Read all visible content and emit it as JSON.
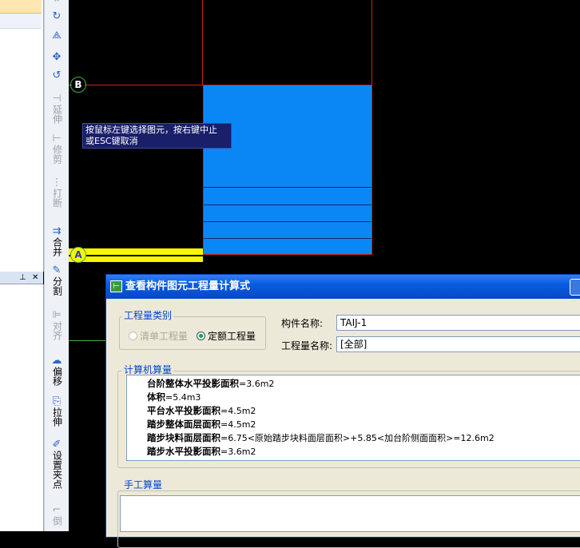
{
  "toolbar": {
    "extend": "延伸",
    "trim": "修剪",
    "break": "打断",
    "merge": "合并",
    "split": "分割",
    "align": "对齐",
    "offset": "偏移",
    "stretch": "拉伸",
    "set_grip": "设置夹点",
    "chamfer": "倒"
  },
  "canvas": {
    "axis_b": "B",
    "axis_a": "A",
    "tooltip_line1": "按鼠标左键选择图元，按右键中止",
    "tooltip_line2": "或ESC键取消"
  },
  "dialog": {
    "title": "查看构件图元工程量计算式",
    "quantity_type_group": "工程量类别",
    "radio_list_quantity": "清单工程量",
    "radio_quota_quantity": "定额工程量",
    "selected_type": "定额工程量",
    "component_name_label": "构件名称:",
    "component_name_value": "TAIJ-1",
    "quantity_name_label": "工程量名称:",
    "quantity_name_value": "[全部]",
    "computer_calc_group": "计算机算量",
    "formulas": [
      {
        "name": "台阶整体水平投影面积",
        "expr": "=3.6m2"
      },
      {
        "name": "体积",
        "expr": "=5.4m3"
      },
      {
        "name": "平台水平投影面积",
        "expr": "=4.5m2"
      },
      {
        "name": "踏步整体面层面积",
        "expr": "=4.5m2"
      },
      {
        "name": "踏步块料面层面积",
        "expr": "=6.75<原始踏步块料面层面积>+5.85<加台阶侧面面积>=12.6m2"
      },
      {
        "name": "踏步水平投影面积",
        "expr": "=3.6m2"
      }
    ],
    "manual_calc_group": "手工算量"
  },
  "colors": {
    "canvas_bg": "#000000",
    "slab_fill": "#0b87f5",
    "axis_line": "#d32020",
    "highlight": "#f7f700",
    "dialog_title": "#0a5be0"
  }
}
